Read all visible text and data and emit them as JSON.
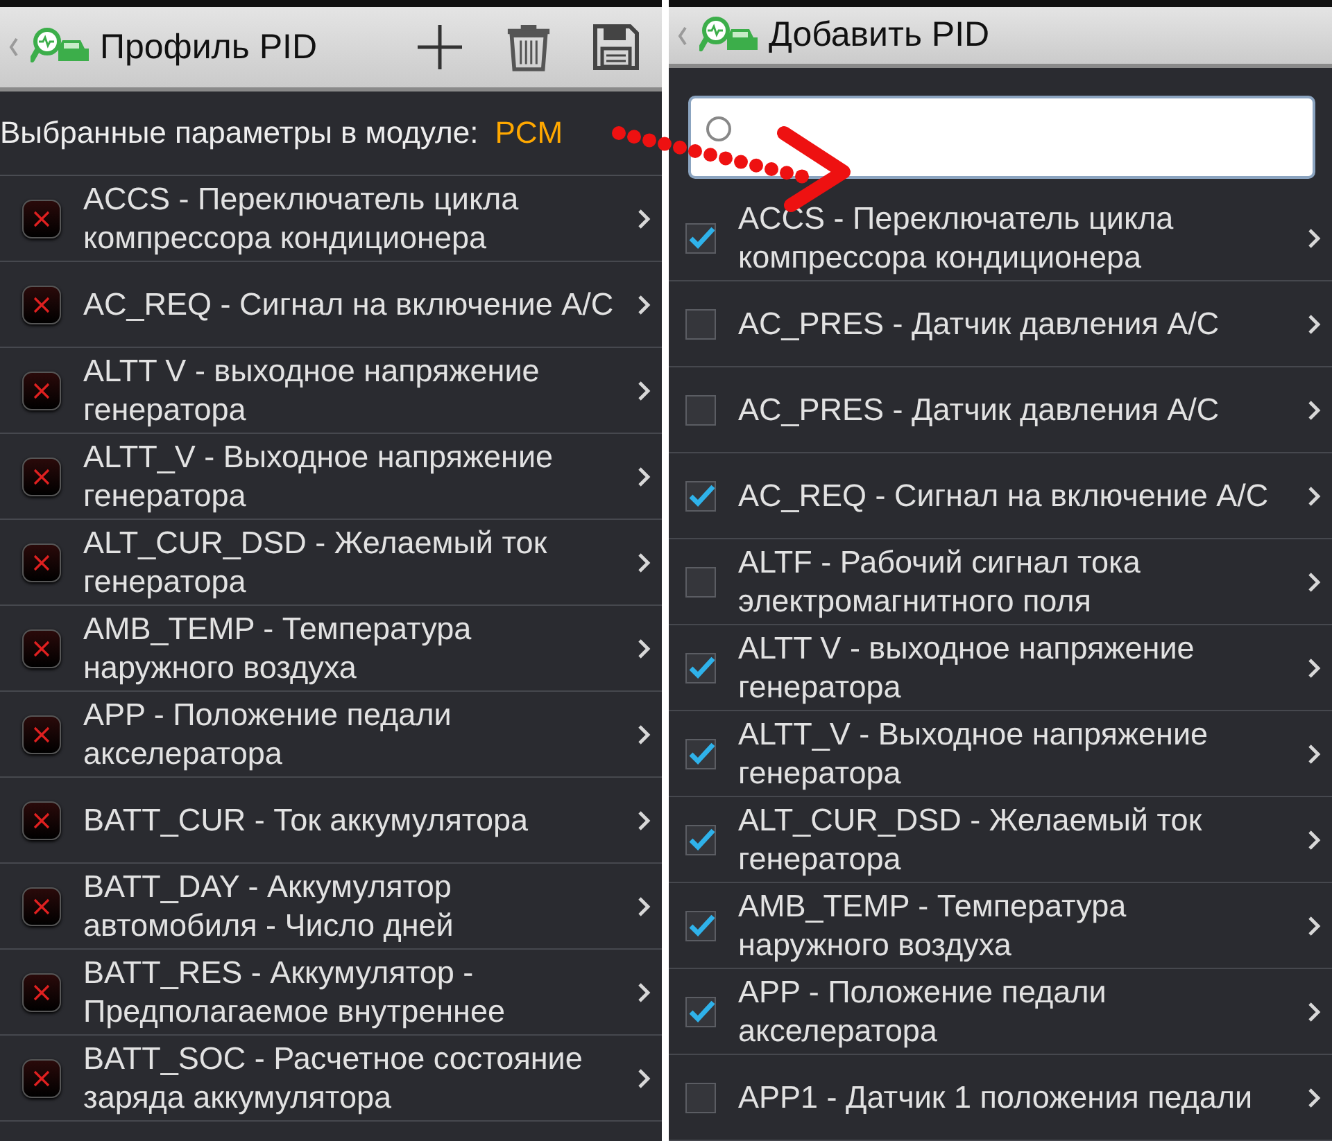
{
  "left_screen": {
    "title": "Профиль PID",
    "module_label": "Выбранные параметры в модуле:",
    "module_value": "PCM",
    "items": [
      {
        "text": "ACCS - Переключатель цикла компрессора кондиционера"
      },
      {
        "text": "AC_REQ - Сигнал на включение A/C"
      },
      {
        "text": "ALTT V - выходное напряжение генератора"
      },
      {
        "text": "ALTT_V - Выходное напряжение генератора"
      },
      {
        "text": "ALT_CUR_DSD - Желаемый ток генератора"
      },
      {
        "text": "AMB_TEMP - Температура наружного воздуха"
      },
      {
        "text": "APP - Положение педали акселератора"
      },
      {
        "text": "BATT_CUR - Ток аккумулятора"
      },
      {
        "text": "BATT_DAY - Аккумулятор автомобиля - Число дней"
      },
      {
        "text": "BATT_RES - Аккумулятор - Предполагаемое внутреннее"
      },
      {
        "text": "BATT_SOC - Расчетное состояние заряда аккумулятора"
      }
    ]
  },
  "right_screen": {
    "title": "Добавить PID",
    "items": [
      {
        "text": "ACCS - Переключатель цикла компрессора кондиционера",
        "checked": true
      },
      {
        "text": "AC_PRES - Датчик давления A/C",
        "checked": false
      },
      {
        "text": "AC_PRES - Датчик давления A/C",
        "checked": false
      },
      {
        "text": "AC_REQ - Сигнал на включение A/C",
        "checked": true
      },
      {
        "text": "ALTF - Рабочий сигнал тока электромагнитного поля",
        "checked": false
      },
      {
        "text": "ALTT V - выходное напряжение генератора",
        "checked": true
      },
      {
        "text": "ALTT_V - Выходное напряжение генератора",
        "checked": true
      },
      {
        "text": "ALT_CUR_DSD - Желаемый ток генератора",
        "checked": true
      },
      {
        "text": "AMB_TEMP - Температура наружного воздуха",
        "checked": true
      },
      {
        "text": "APP - Положение педали акселератора",
        "checked": true
      },
      {
        "text": "APP1 - Датчик 1 положения педали",
        "checked": false
      }
    ]
  }
}
